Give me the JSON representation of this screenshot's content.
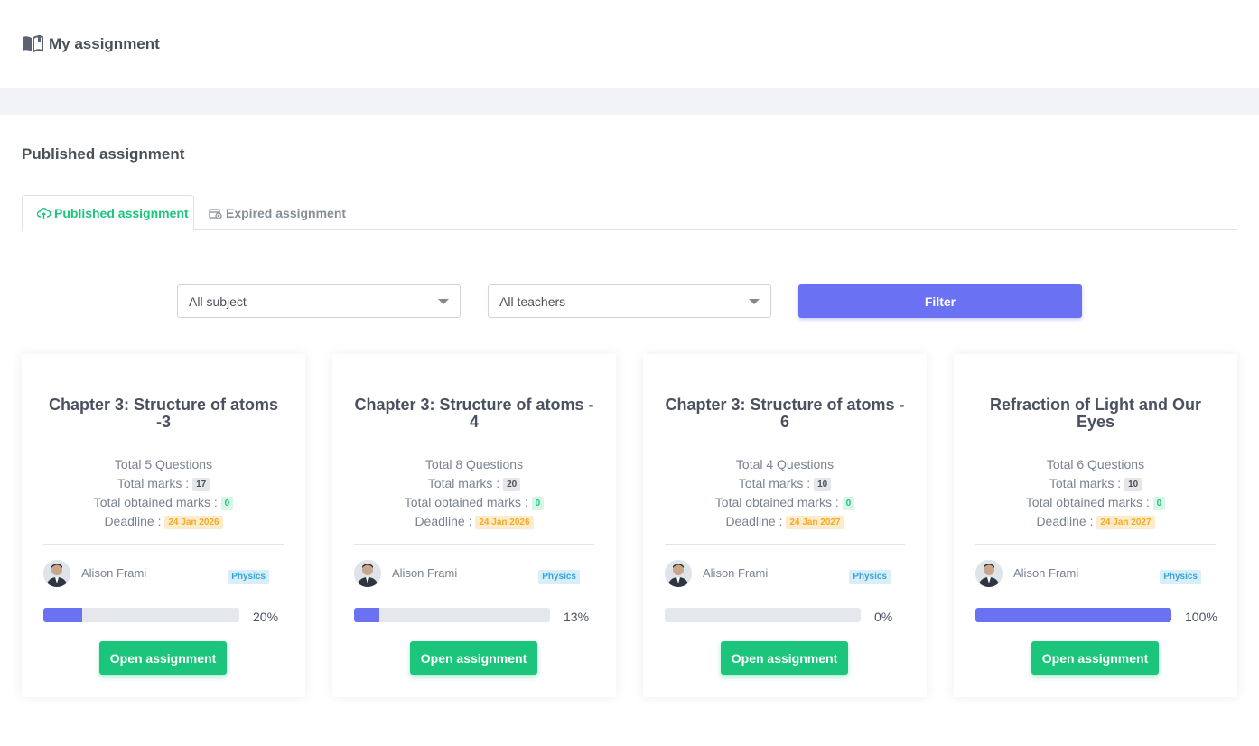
{
  "header": {
    "title": "My assignment",
    "icon": "book-open-icon"
  },
  "section": {
    "title": "Published assignment"
  },
  "tabs": [
    {
      "label": "Published assignment",
      "icon": "cloud-upload-icon",
      "active": true
    },
    {
      "label": "Expired assignment",
      "icon": "calendar-x-icon",
      "active": false
    }
  ],
  "filters": {
    "subject": "All subject",
    "teacher": "All teachers",
    "button": "Filter"
  },
  "colors": {
    "accent": "#6a71f3",
    "success": "#1bc67c",
    "warning": "#f7a928",
    "info": "#3aa3d6"
  },
  "cards": [
    {
      "title": "Chapter 3: Structure of atoms -3",
      "questions": "Total 5 Questions",
      "marks_label": "Total marks :",
      "marks": "17",
      "obtained_label": "Total obtained marks :",
      "obtained": "0",
      "deadline_label": "Deadline :",
      "deadline": "24 Jan 2026",
      "author": "Alison Frami",
      "subject": "Physics",
      "progress": 0.2,
      "percent": "20%",
      "button": "Open assignment"
    },
    {
      "title": "Chapter 3: Structure of atoms - 4",
      "questions": "Total 8 Questions",
      "marks_label": "Total marks :",
      "marks": "20",
      "obtained_label": "Total obtained marks :",
      "obtained": "0",
      "deadline_label": "Deadline :",
      "deadline": "24 Jan 2026",
      "author": "Alison Frami",
      "subject": "Physics",
      "progress": 0.13,
      "percent": "13%",
      "button": "Open assignment"
    },
    {
      "title": "Chapter 3: Structure of atoms - 6",
      "questions": "Total 4 Questions",
      "marks_label": "Total marks :",
      "marks": "10",
      "obtained_label": "Total obtained marks :",
      "obtained": "0",
      "deadline_label": "Deadline :",
      "deadline": "24 Jan 2027",
      "author": "Alison Frami",
      "subject": "Physics",
      "progress": 0.0,
      "percent": "0%",
      "button": "Open assignment"
    },
    {
      "title": "Refraction of Light and Our Eyes",
      "questions": "Total 6 Questions",
      "marks_label": "Total marks :",
      "marks": "10",
      "obtained_label": "Total obtained marks :",
      "obtained": "0",
      "deadline_label": "Deadline :",
      "deadline": "24 Jan 2027",
      "author": "Alison Frami",
      "subject": "Physics",
      "progress": 1.0,
      "percent": "100%",
      "button": "Open assignment"
    }
  ]
}
